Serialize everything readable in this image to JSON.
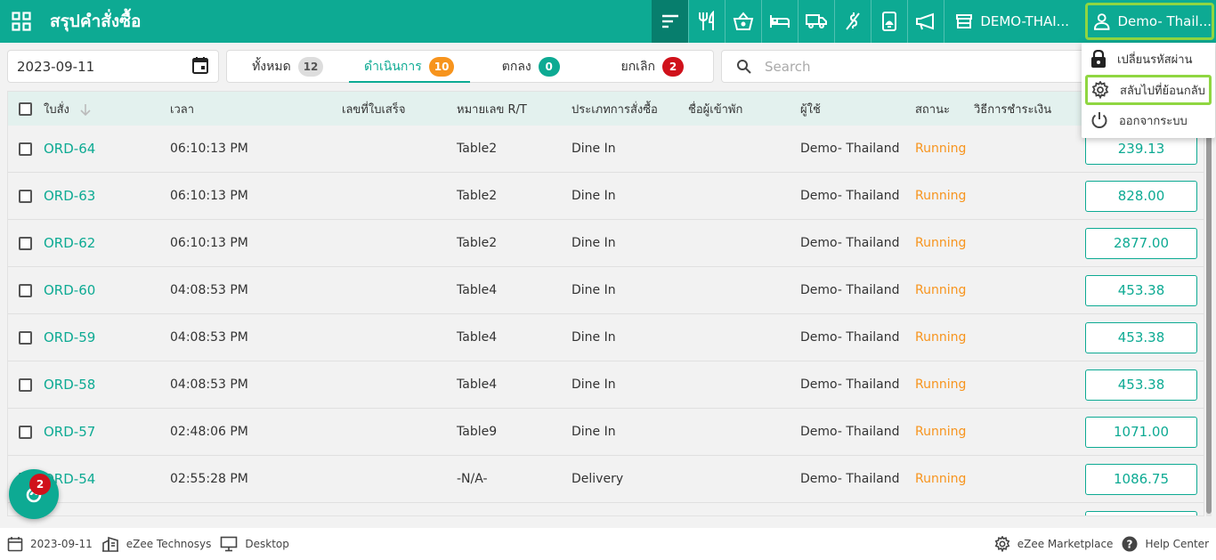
{
  "header": {
    "title": "สรุปคำสั่งซื้อ",
    "outlet": "DEMO-THAI...",
    "user": "Demo- Thail..."
  },
  "user_menu": {
    "items": [
      {
        "label": "เปลี่ยนรหัสผ่าน",
        "icon": "lock-icon"
      },
      {
        "label": "สลับไปที่ย้อนกลับ",
        "icon": "gear-icon"
      },
      {
        "label": "ออกจากระบบ",
        "icon": "power-icon"
      }
    ]
  },
  "filters": {
    "date": "2023-09-11",
    "search_placeholder": "Search",
    "tabs": [
      {
        "label": "ทั้งหมด",
        "count": "12"
      },
      {
        "label": "ดำเนินการ",
        "count": "10"
      },
      {
        "label": "ตกลง",
        "count": "0"
      },
      {
        "label": "ยกเลิก",
        "count": "2"
      }
    ]
  },
  "table": {
    "headers": {
      "order": "ใบสั่ง",
      "time": "เวลา",
      "bill": "เลขที่ใบเสร็จ",
      "rt": "หมายเลข R/T",
      "type": "ประเภทการสั่งซื้อ",
      "guest": "ชื่อผู้เข้าพัก",
      "user": "ผู้ใช้",
      "status": "สถานะ",
      "payment": "วิธีการชำระเงิน"
    },
    "rows": [
      {
        "order": "ORD-64",
        "time": "06:10:13 PM",
        "bill": "",
        "rt": "Table2",
        "type": "Dine In",
        "guest": "",
        "user": "Demo- Thailand",
        "status": "Running",
        "payment": "",
        "amount": "239.13"
      },
      {
        "order": "ORD-63",
        "time": "06:10:13 PM",
        "bill": "",
        "rt": "Table2",
        "type": "Dine In",
        "guest": "",
        "user": "Demo- Thailand",
        "status": "Running",
        "payment": "",
        "amount": "828.00"
      },
      {
        "order": "ORD-62",
        "time": "06:10:13 PM",
        "bill": "",
        "rt": "Table2",
        "type": "Dine In",
        "guest": "",
        "user": "Demo- Thailand",
        "status": "Running",
        "payment": "",
        "amount": "2877.00"
      },
      {
        "order": "ORD-60",
        "time": "04:08:53 PM",
        "bill": "",
        "rt": "Table4",
        "type": "Dine In",
        "guest": "",
        "user": "Demo- Thailand",
        "status": "Running",
        "payment": "",
        "amount": "453.38"
      },
      {
        "order": "ORD-59",
        "time": "04:08:53 PM",
        "bill": "",
        "rt": "Table4",
        "type": "Dine In",
        "guest": "",
        "user": "Demo- Thailand",
        "status": "Running",
        "payment": "",
        "amount": "453.38"
      },
      {
        "order": "ORD-58",
        "time": "04:08:53 PM",
        "bill": "",
        "rt": "Table4",
        "type": "Dine In",
        "guest": "",
        "user": "Demo- Thailand",
        "status": "Running",
        "payment": "",
        "amount": "453.38"
      },
      {
        "order": "ORD-57",
        "time": "02:48:06 PM",
        "bill": "",
        "rt": "Table9",
        "type": "Dine In",
        "guest": "",
        "user": "Demo- Thailand",
        "status": "Running",
        "payment": "",
        "amount": "1071.00"
      },
      {
        "order": "ORD-54",
        "time": "02:55:28 PM",
        "bill": "",
        "rt": "-N/A-",
        "type": "Delivery",
        "guest": "",
        "user": "Demo- Thailand",
        "status": "Running",
        "payment": "",
        "amount": "1086.75"
      }
    ]
  },
  "fab": {
    "badge": "2"
  },
  "footer": {
    "date": "2023-09-11",
    "company": "eZee Technosys",
    "mode": "Desktop",
    "marketplace": "eZee Marketplace",
    "help": "Help Center"
  },
  "colors": {
    "brand": "#0daa93",
    "running": "#f7941d",
    "highlight": "#8fd641",
    "cancel": "#d0111b"
  }
}
